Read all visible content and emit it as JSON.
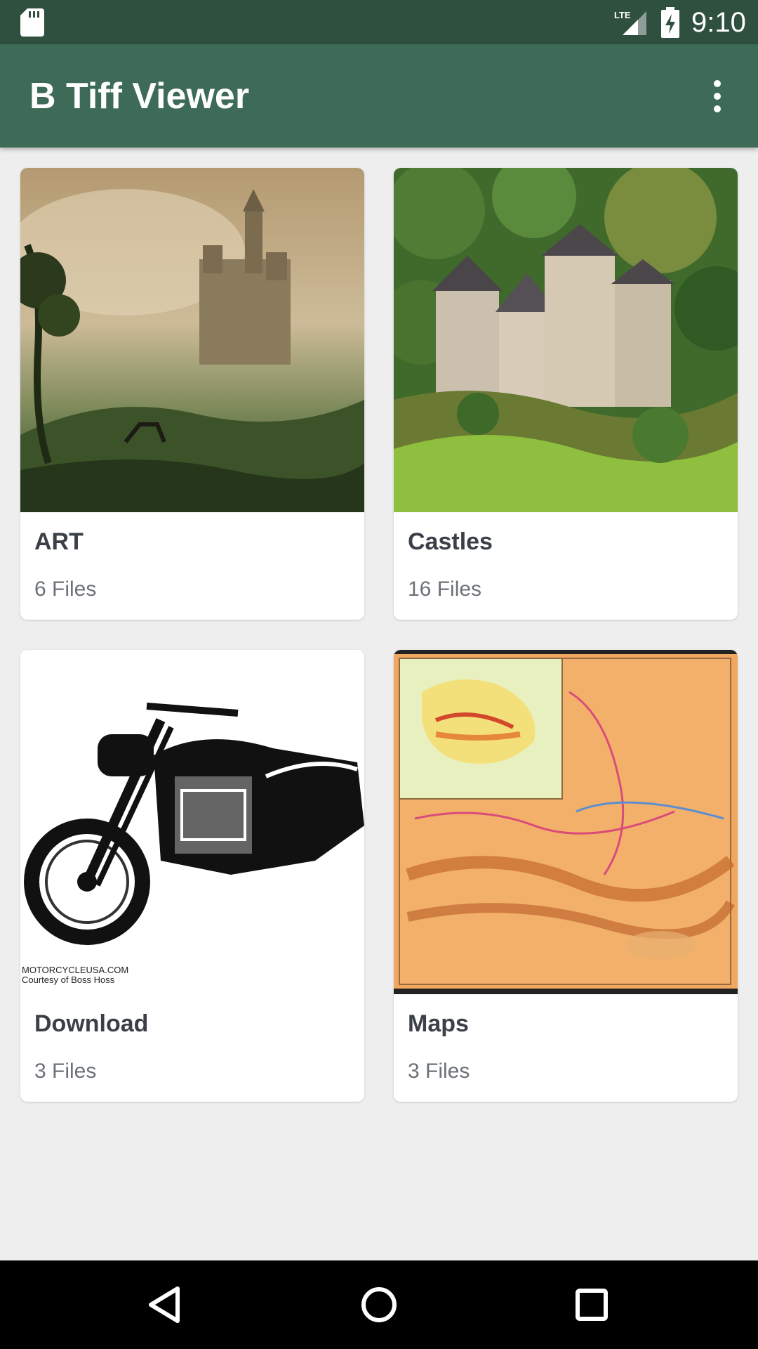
{
  "status_bar": {
    "time": "9:10",
    "network_label": "LTE",
    "icons": [
      "sd-card-icon",
      "lte-signal-icon",
      "battery-charging-icon"
    ]
  },
  "app_bar": {
    "title": "B Tiff Viewer",
    "menu_icon": "more-vert-icon"
  },
  "folders": [
    {
      "name": "ART",
      "count": "6 Files"
    },
    {
      "name": "Castles",
      "count": "16 Files"
    },
    {
      "name": "Download",
      "count": "3 Files"
    },
    {
      "name": "Maps",
      "count": "3 Files"
    }
  ],
  "thumbnail_caption": {
    "line1": "MOTORCYCLEUSA.COM",
    "line2": "Courtesy of Boss Hoss"
  },
  "nav_bar": {
    "icons": [
      "back-icon",
      "home-icon",
      "recents-icon"
    ]
  },
  "colors": {
    "status_bar": "#2f4f3f",
    "app_bar": "#3d6b57",
    "background": "#eeeeee"
  }
}
